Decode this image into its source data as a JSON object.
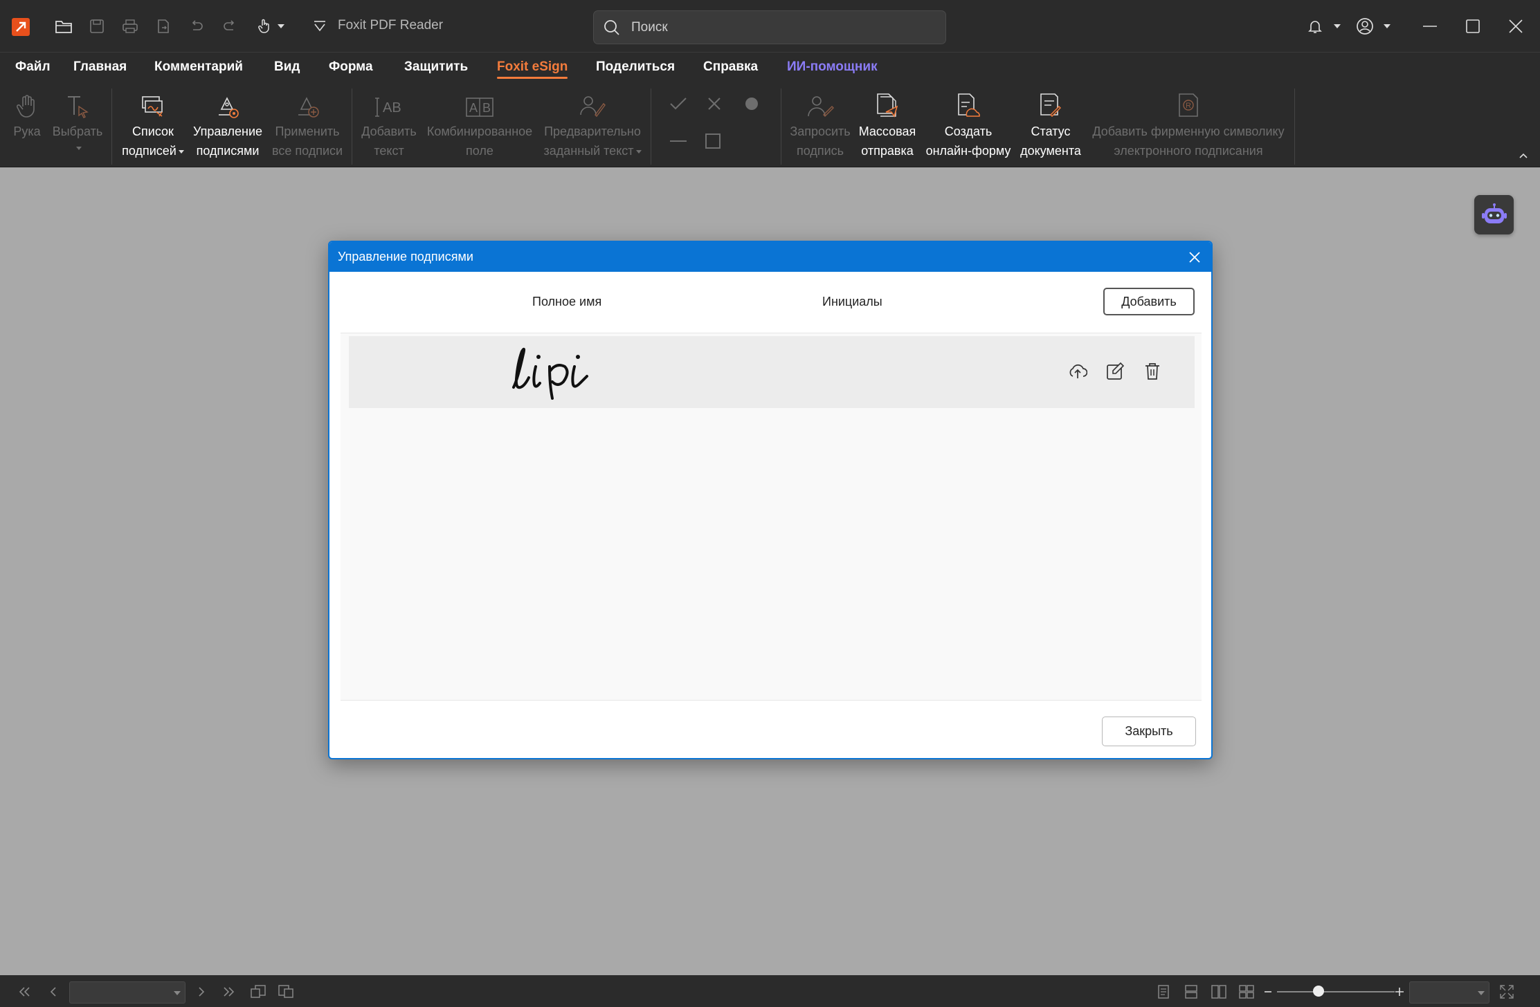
{
  "app": {
    "title": "Foxit PDF Reader",
    "search_placeholder": "Поиск"
  },
  "menu": [
    {
      "label": "Файл"
    },
    {
      "label": "Главная"
    },
    {
      "label": "Комментарий"
    },
    {
      "label": "Вид"
    },
    {
      "label": "Форма"
    },
    {
      "label": "Защитить"
    },
    {
      "label": "Foxit eSign",
      "active": true
    },
    {
      "label": "Поделиться"
    },
    {
      "label": "Справка"
    },
    {
      "label": "ИИ-помощник"
    }
  ],
  "ribbon": {
    "hand": {
      "line1": "Рука",
      "line2": "",
      "enabled": false
    },
    "select": {
      "line1": "Выбрать",
      "line2": "",
      "enabled": false
    },
    "sig_list": {
      "line1": "Список",
      "line2": "подписей",
      "enabled": true
    },
    "manage_sigs": {
      "line1": "Управление",
      "line2": "подписями",
      "enabled": true
    },
    "apply_all": {
      "line1": "Применить",
      "line2": "все подписи",
      "enabled": false
    },
    "add_text": {
      "line1": "Добавить",
      "line2": "текст",
      "enabled": false
    },
    "combo_field": {
      "line1": "Комбинированное",
      "line2": "поле",
      "enabled": false
    },
    "predefined_text": {
      "line1": "Предварительно",
      "line2": "заданный текст",
      "enabled": false
    },
    "request_sig": {
      "line1": "Запросить",
      "line2": "подпись",
      "enabled": false
    },
    "bulk_send": {
      "line1": "Массовая",
      "line2": "отправка",
      "enabled": true
    },
    "online_form": {
      "line1": "Создать",
      "line2": "онлайн-форму",
      "enabled": true
    },
    "doc_status": {
      "line1": "Статус",
      "line2": "документа",
      "enabled": true
    },
    "branding": {
      "line1": "Добавить фирменную символику",
      "line2": "электронного подписания",
      "enabled": false
    }
  },
  "dialog": {
    "title": "Управление подписями",
    "col_fullname": "Полное имя",
    "col_initials": "Инициалы",
    "add_label": "Добавить",
    "close_label": "Закрыть",
    "signatures": [
      {
        "fullname_image_text": "lipi",
        "initials": ""
      }
    ]
  },
  "statusbar": {
    "page_value": "",
    "zoom_value": "",
    "zoom_level": 0.35
  },
  "colors": {
    "accent_orange": "#f47c3c",
    "ai_purple": "#8b7cf6",
    "dialog_blue": "#0a74d4",
    "chrome": "#2b2b2b",
    "workspace": "#a9a9a9"
  }
}
